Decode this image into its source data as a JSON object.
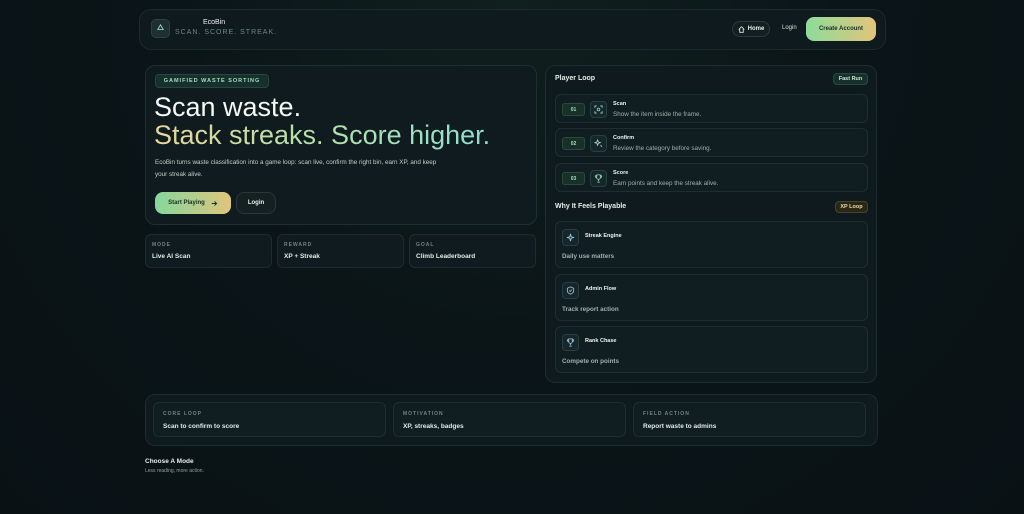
{
  "header": {
    "logo_icon": "recycle-icon",
    "brand_name": "EcoBin",
    "tagline": "SCAN. SCORE. STREAK.",
    "home_label": "Home",
    "home_icon": "home-icon",
    "login_label": "Login",
    "create_account_label": "Create Account"
  },
  "hero": {
    "badge": "GAMIFIED WASTE SORTING",
    "title_line1": "Scan waste.",
    "title_line2": "Stack streaks. Score higher.",
    "description": "EcoBin turns waste classification into a game loop: scan live, confirm the right bin, earn XP, and keep your streak alive.",
    "start_label": "Start Playing",
    "start_icon": "arrow-right-icon",
    "login_label": "Login"
  },
  "stats": [
    {
      "label": "MODE",
      "value": "Live AI Scan"
    },
    {
      "label": "REWARD",
      "value": "XP + Streak"
    },
    {
      "label": "GOAL",
      "value": "Climb Leaderboard"
    }
  ],
  "player_loop": {
    "title": "Player Loop",
    "badge": "Fast Run",
    "steps": [
      {
        "num": "01",
        "title": "Scan",
        "desc": "Show the item inside the frame.",
        "icon": "scan-icon"
      },
      {
        "num": "02",
        "title": "Confirm",
        "desc": "Review the category before saving.",
        "icon": "sparkle-icon"
      },
      {
        "num": "03",
        "title": "Score",
        "desc": "Earn points and keep the streak alive.",
        "icon": "trophy-icon"
      }
    ]
  },
  "playable": {
    "title": "Why It Feels Playable",
    "badge": "XP Loop",
    "features": [
      {
        "title": "Streak Engine",
        "desc": "Daily use matters",
        "icon": "sparkle-icon"
      },
      {
        "title": "Admin Flow",
        "desc": "Track report action",
        "icon": "shield-icon"
      },
      {
        "title": "Rank Chase",
        "desc": "Compete on points",
        "icon": "trophy-icon"
      }
    ]
  },
  "bottom": [
    {
      "label": "CORE LOOP",
      "value": "Scan to confirm to score"
    },
    {
      "label": "MOTIVATION",
      "value": "XP, streaks, badges"
    },
    {
      "label": "FIELD ACTION",
      "value": "Report waste to admins"
    }
  ],
  "choose": {
    "title": "Choose A Mode",
    "subtitle": "Less reading, more action."
  },
  "colors": {
    "accent_green": "#86d79d",
    "accent_gold": "#dfc57c",
    "background": "#0b1518"
  }
}
